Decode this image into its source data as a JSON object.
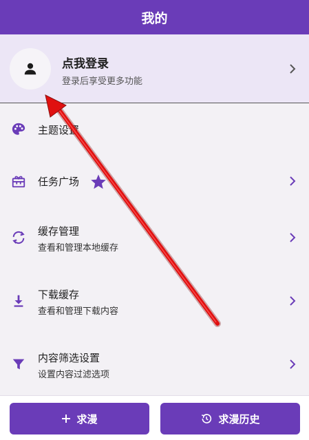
{
  "appbar": {
    "title": "我的"
  },
  "login": {
    "avatar_icon": "person-icon",
    "title": "点我登录",
    "subtitle": "登录后享受更多功能"
  },
  "menu": [
    {
      "icon": "palette-icon",
      "title": "主题设置",
      "subtitle": ""
    },
    {
      "icon": "gift-icon",
      "title": "任务广场",
      "subtitle": "",
      "badge_icon": "star-icon"
    },
    {
      "icon": "sync-icon",
      "title": "缓存管理",
      "subtitle": "查看和管理本地缓存"
    },
    {
      "icon": "download-icon",
      "title": "下载缓存",
      "subtitle": "查看和管理下载内容"
    },
    {
      "icon": "filter-icon",
      "title": "内容筛选设置",
      "subtitle": "设置内容过滤选项"
    }
  ],
  "bottom": {
    "request_label": "求漫",
    "history_label": "求漫历史"
  },
  "colors": {
    "primary": "#6a3cb8",
    "login_bg": "#ece6f6",
    "annotation_arrow": "#e01010"
  }
}
